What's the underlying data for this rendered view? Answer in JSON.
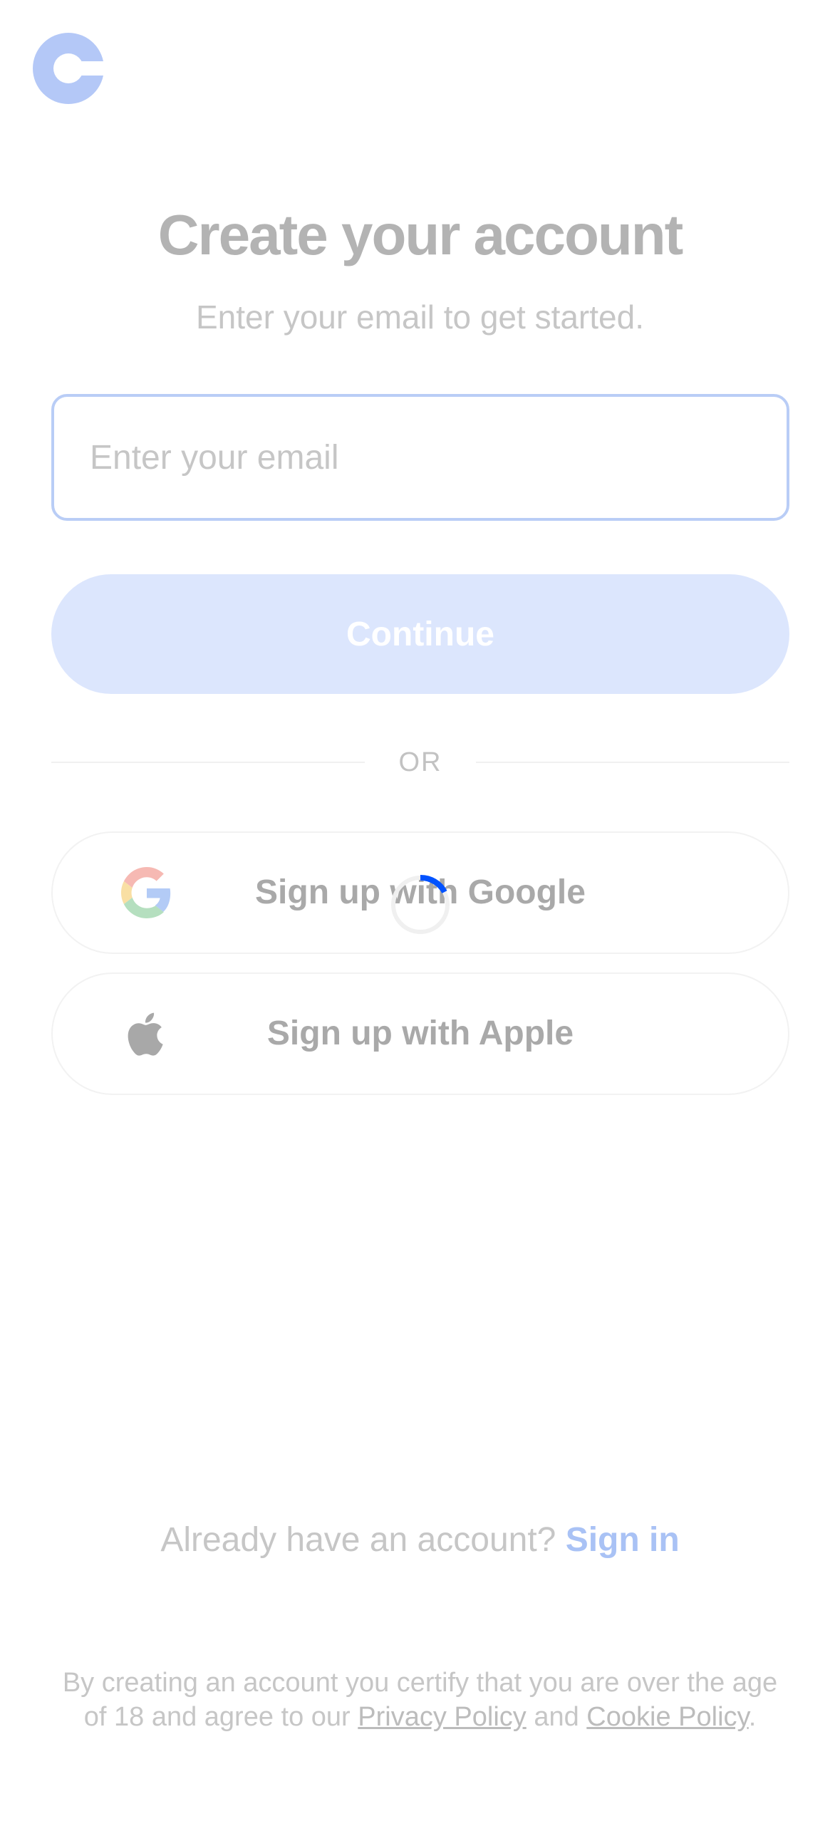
{
  "header": {
    "logo_icon": "coinbase-logo-icon",
    "logo_color": "#b4c8f7"
  },
  "main": {
    "title": "Create your account",
    "subtitle": "Enter your email to get started.",
    "email": {
      "value": "",
      "placeholder": "Enter your email"
    },
    "continue_label": "Continue",
    "divider_label": "OR",
    "google_label": "Sign up with Google",
    "google_icon": "google-icon",
    "apple_label": "Sign up with Apple",
    "apple_icon": "apple-icon",
    "loading_icon": "loading-spinner-icon"
  },
  "footer": {
    "signin_prompt": "Already have an account?",
    "signin_link": "Sign in",
    "legal_prefix": "By creating an account you certify that you are over the age of 18 and agree to our",
    "privacy_link": "Privacy Policy",
    "legal_and": "and",
    "cookie_link": "Cookie Policy",
    "legal_suffix": "."
  },
  "colors": {
    "accent": "#0052ff",
    "button_disabled": "#dce6fd",
    "input_border": "#b9cdf6"
  }
}
